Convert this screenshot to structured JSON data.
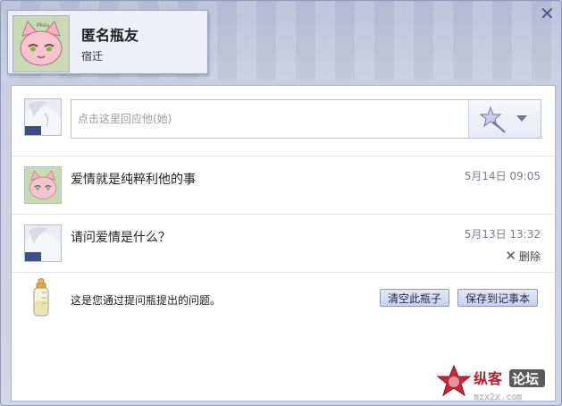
{
  "window": {
    "close_label": "✕"
  },
  "profile": {
    "name": "匿名瓶友",
    "location": "宿迁"
  },
  "reply": {
    "placeholder": "点击这里回应他(她)"
  },
  "messages": [
    {
      "text": "爱情就是纯粹利他的事",
      "time": "5月14日 09:05"
    },
    {
      "text": "请问爱情是什么？",
      "time": "5月13日 13:32",
      "delete_label": "删除"
    }
  ],
  "bottle": {
    "info": "这是您通过提问瓶提出的问题。",
    "clear_label": "清空此瓶子",
    "save_label": "保存到记事本"
  },
  "watermark": {
    "line1": "纵客",
    "line2": "论坛",
    "url": "mzx2x.com"
  },
  "colors": {
    "accent": "#c9d0ea",
    "frame": "#c9cfe2",
    "cat_pink": "#f4b3c0"
  }
}
